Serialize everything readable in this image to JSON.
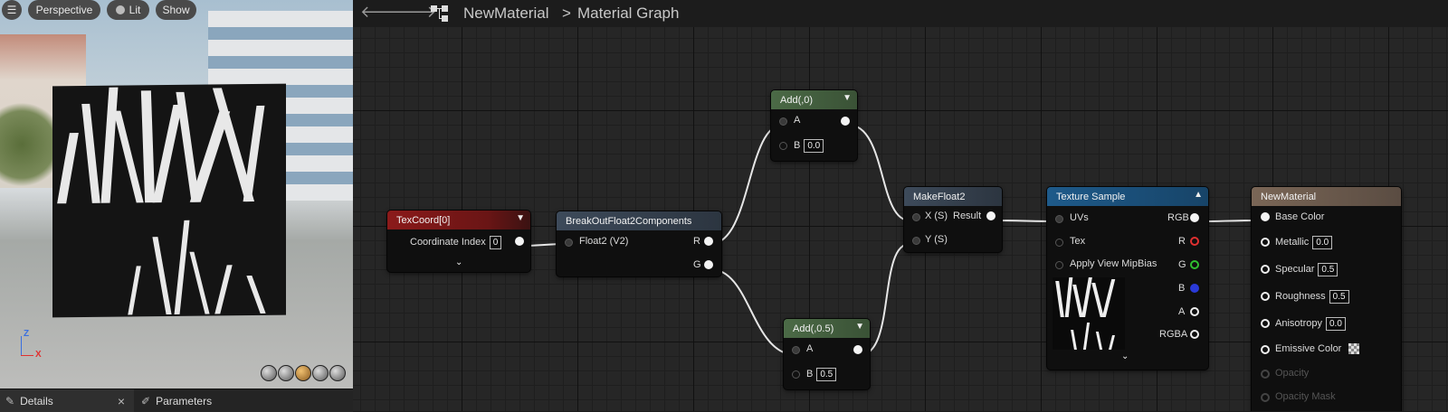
{
  "viewport": {
    "perspective_label": "Perspective",
    "lit_label": "Lit",
    "show_label": "Show",
    "axis_z": "Z",
    "axis_x": "X"
  },
  "bottom_tabs": {
    "details_label": "Details",
    "parameters_label": "Parameters",
    "close_glyph": "×"
  },
  "graph_toolbar": {
    "back_icon": "arrow-left-icon",
    "forward_icon": "arrow-right-icon",
    "breadcrumb_root": "NewMaterial",
    "breadcrumb_separator": ">",
    "breadcrumb_current": "Material Graph"
  },
  "nodes": {
    "texcoord": {
      "title": "TexCoord[0]",
      "row_label": "Coordinate Index",
      "row_value": "0",
      "color": "#8b1a1a"
    },
    "breakout": {
      "title": "BreakOutFloat2Components",
      "input": "Float2 (V2)",
      "out_r": "R",
      "out_g": "G",
      "color": "#3d4a5a"
    },
    "add_top": {
      "title": "Add(,0)",
      "in_a": "A",
      "in_b": "B",
      "b_value": "0.0",
      "color": "#3f5a3c"
    },
    "add_bottom": {
      "title": "Add(,0.5)",
      "in_a": "A",
      "in_b": "B",
      "b_value": "0.5",
      "color": "#3f5a3c"
    },
    "makefloat": {
      "title": "MakeFloat2",
      "in_x": "X (S)",
      "in_y": "Y (S)",
      "out": "Result",
      "color": "#3d4a5a"
    },
    "texsample": {
      "title": "Texture Sample",
      "in_uvs": "UVs",
      "in_tex": "Tex",
      "in_mip": "Apply View MipBias",
      "out_rgb": "RGB",
      "out_r": "R",
      "out_g": "G",
      "out_b": "B",
      "out_a": "A",
      "out_rgba": "RGBA",
      "color": "#1e5a8a"
    },
    "material": {
      "title": "NewMaterial",
      "color": "#6b5a4a",
      "base_color": "Base Color",
      "metallic": "Metallic",
      "metallic_value": "0.0",
      "specular": "Specular",
      "specular_value": "0.5",
      "roughness": "Roughness",
      "roughness_value": "0.5",
      "anisotropy": "Anisotropy",
      "anisotropy_value": "0.0",
      "emissive": "Emissive Color",
      "opacity": "Opacity",
      "opacity_mask": "Opacity Mask"
    }
  },
  "colors": {
    "pin_r": "#e03030",
    "pin_g": "#30c030",
    "pin_b": "#2a3ad8"
  }
}
